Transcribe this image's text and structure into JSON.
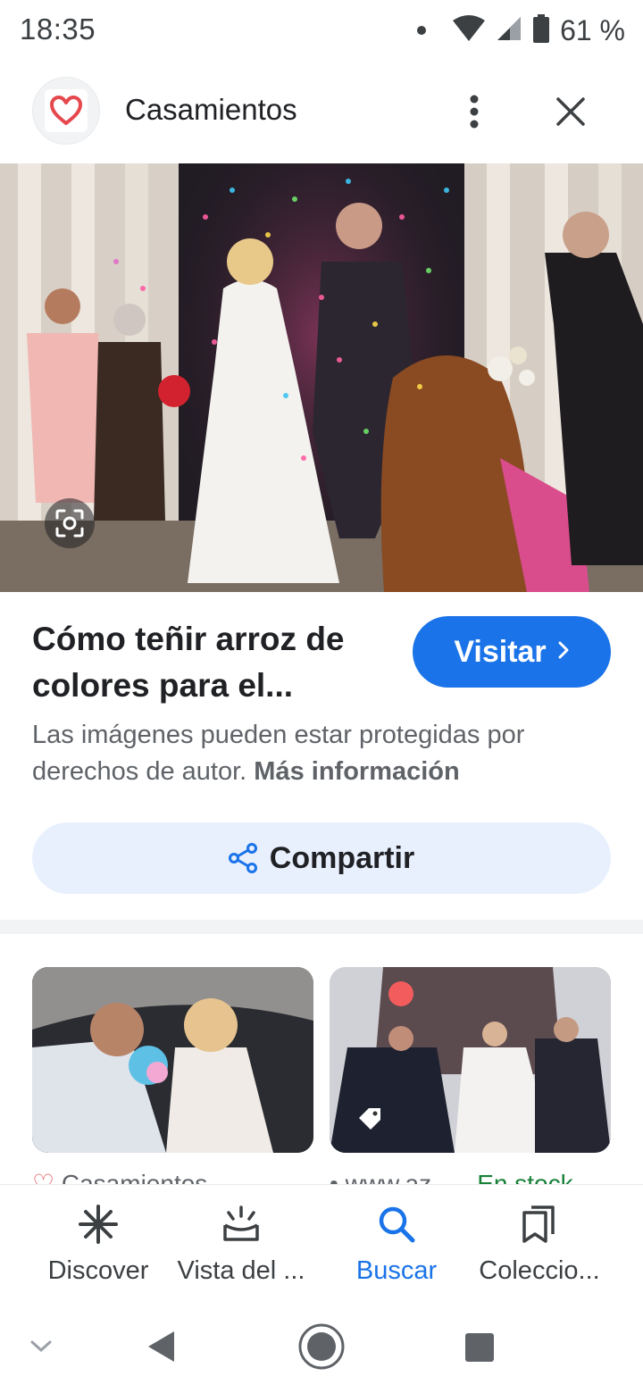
{
  "status_bar": {
    "time": "18:35",
    "battery_percent": "61 %"
  },
  "header": {
    "site_name": "Casamientos",
    "more_icon": "more-vert-icon",
    "close_icon": "close-icon"
  },
  "result": {
    "title_line1": "Cómo teñir arroz de",
    "title_line2": "colores para el...",
    "visit_label": "Visitar",
    "copyright_text": "Las imágenes pueden estar protegidas por derechos de autor.",
    "copyright_link": "Más información",
    "share_label": "Compartir"
  },
  "related": [
    {
      "source": "Casamientos",
      "stock": ""
    },
    {
      "source": "www.az...",
      "stock": "En stock"
    }
  ],
  "bottom_nav": {
    "items": [
      {
        "label": "Discover",
        "icon": "asterisk-icon",
        "active": false
      },
      {
        "label": "Vista del ...",
        "icon": "updates-icon",
        "active": false
      },
      {
        "label": "Buscar",
        "icon": "search-icon",
        "active": true
      },
      {
        "label": "Coleccio...",
        "icon": "collections-icon",
        "active": false
      }
    ]
  },
  "colors": {
    "accent": "#1a73e8",
    "share_bg": "#e8f0fe",
    "brand_heart": "#e5484d",
    "stock_green": "#188038"
  }
}
